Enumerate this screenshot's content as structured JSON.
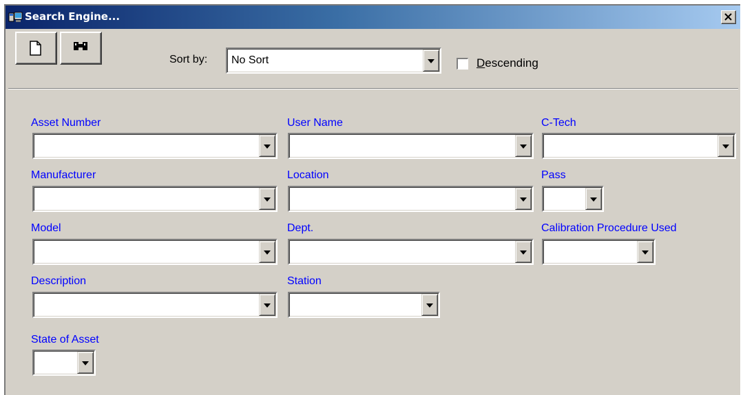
{
  "window": {
    "title": "Search Engine..."
  },
  "toolbar": {
    "new_icon": "new-document-icon",
    "search_icon": "binoculars-icon"
  },
  "sort": {
    "label": "Sort by:",
    "value": "No Sort",
    "descending_label_underlined": "D",
    "descending_label_rest": "escending",
    "descending_checked": false
  },
  "fields": {
    "asset_number": {
      "label": "Asset Number",
      "value": ""
    },
    "user_name": {
      "label": "User Name",
      "value": ""
    },
    "c_tech": {
      "label": "C-Tech",
      "value": ""
    },
    "manufacturer": {
      "label": "Manufacturer",
      "value": ""
    },
    "location": {
      "label": "Location",
      "value": ""
    },
    "pass": {
      "label": "Pass",
      "value": ""
    },
    "model": {
      "label": "Model",
      "value": ""
    },
    "dept": {
      "label": "Dept.",
      "value": ""
    },
    "calibration_procedure": {
      "label": "Calibration Procedure Used",
      "value": ""
    },
    "description": {
      "label": "Description",
      "value": ""
    },
    "station": {
      "label": "Station",
      "value": ""
    },
    "state_of_asset": {
      "label": "State of Asset",
      "value": ""
    }
  },
  "colors": {
    "label_blue": "#0000ff",
    "face": "#d4d0c8",
    "title_dark": "#0a246a",
    "title_light": "#a6caf0"
  }
}
